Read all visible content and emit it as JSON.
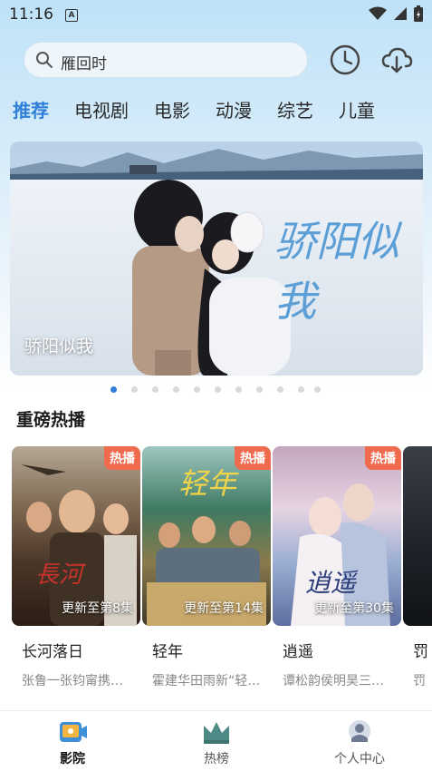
{
  "status_bar": {
    "time": "11:16",
    "badge": "A"
  },
  "search": {
    "placeholder": "雁回时"
  },
  "tabs": [
    {
      "label": "推荐",
      "active": true
    },
    {
      "label": "电视剧"
    },
    {
      "label": "电影"
    },
    {
      "label": "动漫"
    },
    {
      "label": "综艺"
    },
    {
      "label": "儿童"
    }
  ],
  "banner": {
    "title": "骄阳似我",
    "calligraphy": "骄阳似我",
    "page_count": 11,
    "active_index": 0
  },
  "section": {
    "title": "重磅热播"
  },
  "cards": [
    {
      "name": "长河落日",
      "desc": "张鲁一张钧甯携…",
      "badge": "热播",
      "update": "更新至第8集"
    },
    {
      "name": "轻年",
      "desc": "霍建华田雨新“轻…",
      "badge": "热播",
      "update": "更新至第14集"
    },
    {
      "name": "逍遥",
      "desc": "谭松韵侯明昊三…",
      "badge": "热播",
      "update": "更新至第30集"
    },
    {
      "name": "罚",
      "desc": "罚"
    }
  ],
  "bottom_nav": [
    {
      "label": "影院",
      "icon": "cinema-icon",
      "active": true
    },
    {
      "label": "热榜",
      "icon": "crown-icon"
    },
    {
      "label": "个人中心",
      "icon": "profile-icon"
    }
  ],
  "colors": {
    "accent": "#2f7fd8",
    "badge": "#f06b4e"
  }
}
